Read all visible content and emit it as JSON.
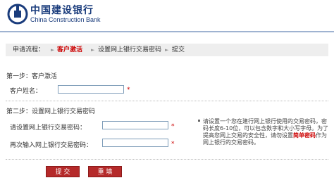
{
  "header": {
    "logo_cn": "中国建设银行",
    "logo_en": "China Construction Bank"
  },
  "process": {
    "label": "申请流程：",
    "steps": [
      "客户激活",
      "设置网上银行交易密码",
      "提交"
    ],
    "active_index": 0
  },
  "section1": {
    "title": "第一步：客户激活",
    "name_label": "客户姓名：",
    "name_value": "",
    "required_mark": "*"
  },
  "section2": {
    "title": "第二步：设置网上银行交易密码",
    "password_label": "请设置网上银行交易密码：",
    "confirm_label": "再次输入网上银行交易密码：",
    "password_value": "",
    "confirm_value": "",
    "required_mark": "*"
  },
  "hint": {
    "part1": "请设置一个您在建行网上银行使用的交易密码，密码长度6-10位，可以包含数字和大小写字母。为了提高您网上交易的安全性，请勿设置",
    "emphasis": "简单密码",
    "part2": "作为网上银行的交易密码。"
  },
  "buttons": {
    "submit": "提 交",
    "reset": "重 填"
  },
  "colors": {
    "brand_blue": "#1a3c7c",
    "accent_red": "#c00000",
    "button_red": "#b52a2a"
  }
}
